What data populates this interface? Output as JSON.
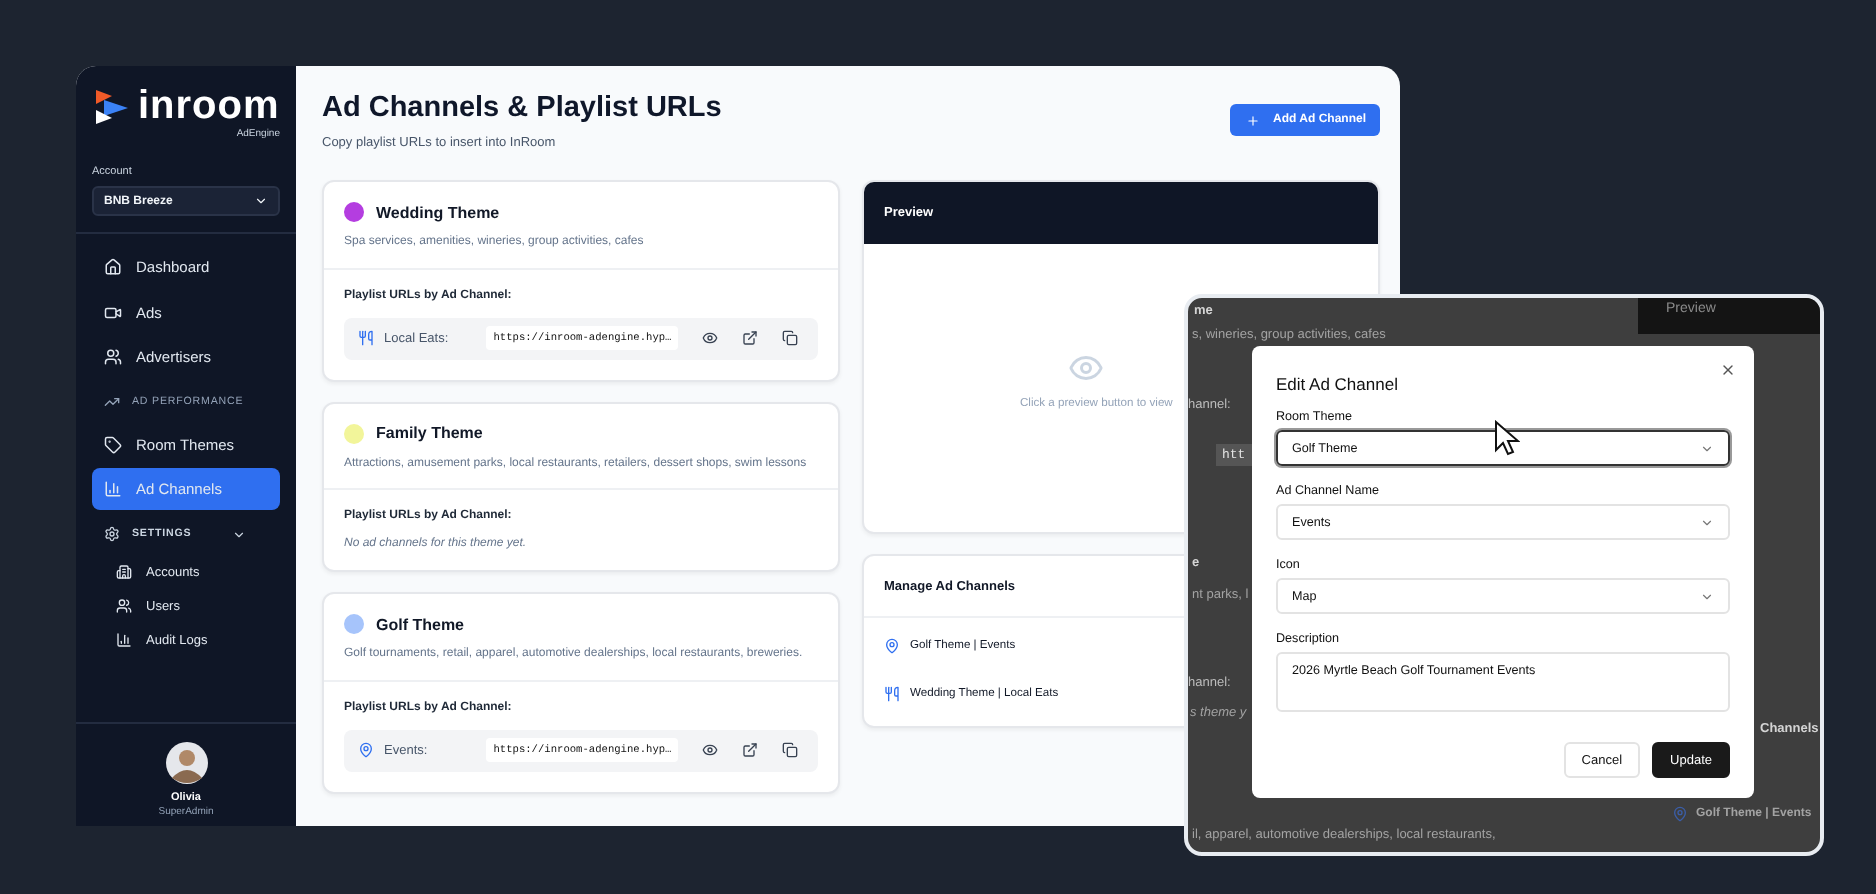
{
  "sidebar": {
    "logo": "inroom",
    "subtitle": "AdEngine",
    "account_label": "Account",
    "account": "BNB Breeze",
    "nav": [
      {
        "kind": "item",
        "label": "Dashboard",
        "selected": false
      },
      {
        "kind": "item",
        "label": "Ads",
        "selected": false
      },
      {
        "kind": "item",
        "label": "Advertisers",
        "selected": false
      },
      {
        "kind": "section",
        "label": "AD PERFORMANCE",
        "expanded": false
      },
      {
        "kind": "item",
        "label": "Room Themes",
        "selected": false
      },
      {
        "kind": "item",
        "label": "Ad Channels",
        "selected": true
      },
      {
        "kind": "section",
        "label": "SETTINGS",
        "expanded": true,
        "children": [
          {
            "label": "Accounts",
            "selected": false
          },
          {
            "label": "Users",
            "selected": false
          },
          {
            "label": "Audit Logs",
            "selected": false
          }
        ]
      }
    ],
    "user": {
      "name": "Olivia",
      "role": "SuperAdmin"
    }
  },
  "header": {
    "title": "Ad Channels & Playlist URLs",
    "subtitle": "Copy playlist URLs to insert into InRoom",
    "add_button": "Add Ad Channel"
  },
  "themes": [
    {
      "name": "Wedding Theme",
      "color": "#b43de0",
      "description": "Spa services, amenities, wineries, group activities, cafes",
      "playlist_label": "Playlist URLs by Ad Channel:",
      "channels": [
        {
          "name": "Local Eats:",
          "url": "https://inroom-adengine.hyp…"
        }
      ]
    },
    {
      "name": "Family Theme",
      "color": "#f2f59a",
      "description": "Attractions, amusement parks, local restaurants, retailers, dessert shops, swim lessons",
      "playlist_label": "Playlist URLs by Ad Channel:",
      "empty_text": "No ad channels for this theme yet."
    },
    {
      "name": "Golf Theme",
      "color": "#a6c4fb",
      "description": "Golf tournaments, retail, apparel, automotive dealerships, local restaurants, breweries.",
      "playlist_label": "Playlist URLs by Ad Channel:",
      "channels": [
        {
          "name": "Events:",
          "url": "https://inroom-adengine.hyp…"
        }
      ]
    }
  ],
  "preview": {
    "title": "Preview",
    "hint": "Click a preview button to view"
  },
  "manage": {
    "title": "Manage Ad Channels",
    "items": [
      {
        "label": "Golf Theme | Events"
      },
      {
        "label": "Wedding Theme | Local Eats"
      }
    ]
  },
  "inset": {
    "backdrop": [
      {
        "kind": "heading",
        "text": "me"
      },
      {
        "kind": "text",
        "text": "s, wineries, group activities, cafes"
      },
      {
        "kind": "label",
        "text": "hannel:"
      },
      {
        "kind": "url",
        "text": "htt"
      },
      {
        "kind": "heading",
        "text": "e"
      },
      {
        "kind": "text",
        "text": "nt parks, l"
      },
      {
        "kind": "label",
        "text": "hannel:"
      },
      {
        "kind": "empty",
        "text": "s theme y"
      },
      {
        "kind": "text",
        "text": "il, apparel, automotive dealerships, local restaurants,"
      },
      {
        "kind": "panel",
        "text": "Preview"
      },
      {
        "kind": "heading",
        "text": "Channels"
      },
      {
        "kind": "item",
        "text": "Golf Theme | Events"
      }
    ],
    "modal": {
      "title": "Edit Ad Channel",
      "fields": [
        {
          "kind": "select",
          "label": "Room Theme",
          "value": "Golf Theme",
          "focused": true
        },
        {
          "kind": "select",
          "label": "Ad Channel Name",
          "value": "Events",
          "focused": false
        },
        {
          "kind": "select",
          "label": "Icon",
          "value": "Map",
          "focused": false
        },
        {
          "kind": "textarea",
          "label": "Description",
          "value": "2026 Myrtle Beach Golf Tournament Events",
          "focused": false
        }
      ],
      "buttons": [
        {
          "kind": "secondary",
          "label": "Cancel"
        },
        {
          "kind": "primary",
          "label": "Update"
        }
      ]
    }
  }
}
